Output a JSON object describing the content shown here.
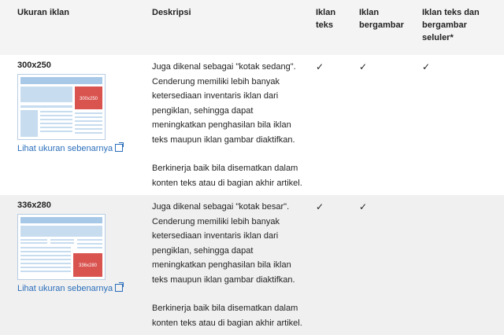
{
  "headers": {
    "size": "Ukuran iklan",
    "description": "Deskripsi",
    "text": "Iklan teks",
    "image": "Iklan bergambar",
    "mobile": "Iklan teks dan bergambar seluler*"
  },
  "rows": [
    {
      "size": "300x250",
      "ad_label": "300x250",
      "link": "Lihat ukuran sebenarnya",
      "desc1": "Juga dikenal sebagai \"kotak sedang\". Cenderung memiliki lebih banyak ketersediaan inventaris iklan dari pengiklan, sehingga dapat meningkatkan penghasilan bila iklan teks maupun iklan gambar diaktifkan.",
      "desc2": "Berkinerja baik bila disematkan dalam konten teks atau di bagian akhir artikel.",
      "text": "✓",
      "image": "✓",
      "mobile": "✓"
    },
    {
      "size": "336x280",
      "ad_label": "336x280",
      "link": "Lihat ukuran sebenarnya",
      "desc1": "Juga dikenal sebagai \"kotak besar\". Cenderung memiliki lebih banyak ketersediaan inventaris iklan dari pengiklan, sehingga dapat meningkatkan penghasilan bila iklan teks maupun iklan gambar diaktifkan.",
      "desc2": "Berkinerja baik bila disematkan dalam konten teks atau di bagian akhir artikel.",
      "text": "✓",
      "image": "✓",
      "mobile": ""
    }
  ],
  "colors": {
    "link": "#2a6ebb",
    "ad_block": "#d9534f",
    "wireframe": "#a8c8e8"
  }
}
